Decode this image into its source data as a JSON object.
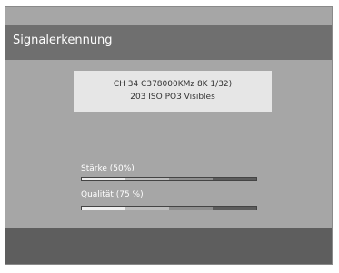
{
  "header": {
    "title": "Signalerkennung"
  },
  "info": {
    "line1": "CH 34 C378000KMz 8K 1/32)",
    "line2": "203 ISO PO3 Visibles"
  },
  "meters": [
    {
      "label": "Stärke (50%)",
      "value_percent": 50
    },
    {
      "label": "Qualität (75 %)",
      "value_percent": 75
    }
  ]
}
